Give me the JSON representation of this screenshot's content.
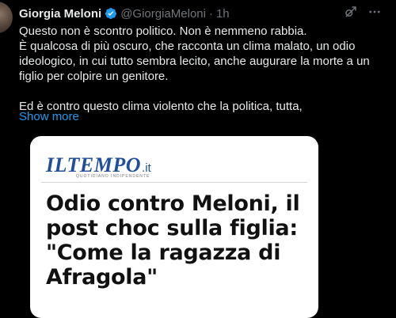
{
  "author": {
    "name": "Giorgia Meloni",
    "handle": "@GiorgiaMeloni",
    "separator": "·",
    "time": "1h"
  },
  "icons": {
    "verified": "verified-badge-icon",
    "grok": "grok-icon",
    "more": "more-icon"
  },
  "tweet": {
    "lines": [
      "Questo non è scontro politico. Non è nemmeno rabbia.",
      "È qualcosa di più oscuro, che racconta un clima malato, un odio ideologico, in cui tutto sembra lecito, anche augurare la morte a un figlio per colpire un genitore.",
      "Ed è contro questo clima violento che la politica, tutta,"
    ],
    "show_more": "Show more"
  },
  "card": {
    "logo": "ILTEMPO",
    "logo_suffix": ".it",
    "logo_tagline": "QUOTIDIANO INDIPENDENTE",
    "headline": "Odio contro Meloni, il post choc sulla figlia: \"Come la ragazza di Afragola\""
  },
  "colors": {
    "background": "#000000",
    "link": "#1d9bf0",
    "verified": "#1d9bf0",
    "logo": "#1f4e9c"
  }
}
